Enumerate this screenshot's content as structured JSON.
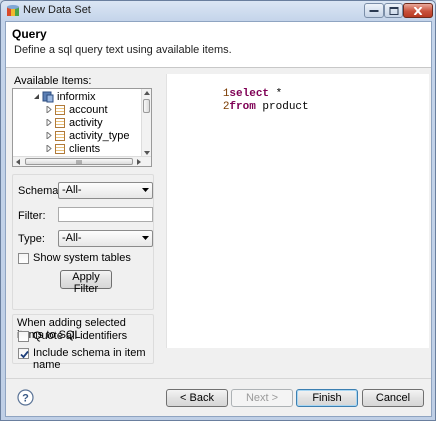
{
  "window": {
    "title": "New Data Set"
  },
  "header": {
    "title": "Query",
    "description": "Define a sql query text using available items."
  },
  "available_items": {
    "label": "Available Items:",
    "root": "informix",
    "items": [
      "account",
      "activity",
      "activity_type",
      "clients",
      "..."
    ]
  },
  "filters": {
    "schema_label": "Schema:",
    "schema_value": "-All-",
    "filter_label": "Filter:",
    "filter_value": "",
    "type_label": "Type:",
    "type_value": "-All-",
    "show_system_tables": "Show system tables",
    "apply_filter": "Apply Filter"
  },
  "options": {
    "heading": "When adding selected items to SQL",
    "quote_all": "Quote all identifiers",
    "include_schema": "Include schema in item name",
    "quote_all_checked": false,
    "include_schema_checked": true
  },
  "editor": {
    "lines": [
      {
        "num": "1",
        "keyword": "select",
        "rest": " *"
      },
      {
        "num": "2",
        "keyword": "from",
        "rest": " product"
      }
    ]
  },
  "footer": {
    "back": "< Back",
    "next": "Next >",
    "finish": "Finish",
    "cancel": "Cancel"
  },
  "colors": {
    "keyword": "#7f0055",
    "line_number": "#7a3b00",
    "title_bar": "#c4d4ea"
  }
}
